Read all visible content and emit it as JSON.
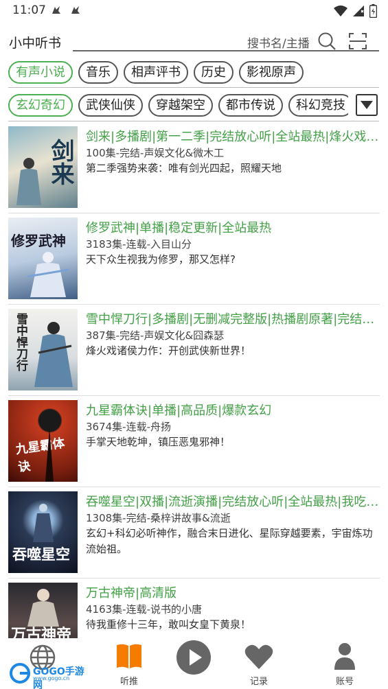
{
  "status_bar": {
    "time": "11:07"
  },
  "header": {
    "title": "小中听书",
    "search_placeholder": "搜书名/主播"
  },
  "main_categories": [
    {
      "label": "有声小说",
      "active": true
    },
    {
      "label": "音乐",
      "active": false
    },
    {
      "label": "相声评书",
      "active": false
    },
    {
      "label": "历史",
      "active": false
    },
    {
      "label": "影视原声",
      "active": false
    }
  ],
  "sub_categories": [
    {
      "label": "玄幻奇幻",
      "active": true
    },
    {
      "label": "武侠仙侠",
      "active": false
    },
    {
      "label": "穿越架空",
      "active": false
    },
    {
      "label": "都市传说",
      "active": false
    },
    {
      "label": "科幻竞技",
      "active": false
    }
  ],
  "books": [
    {
      "cover_text": "剑来",
      "title": "剑来|多播剧|第一二季|完结放心听|全站最热|烽火戏诸侯",
      "meta": "100集-完结-声娱文化&微木工",
      "desc": "第二季强势来袭：唯有剑光四起，照耀天地"
    },
    {
      "cover_text": "修罗武神",
      "title": "修罗武神|单播|稳定更新|全站最热",
      "meta": "3183集-连载-入目山分",
      "desc": "天下众生视我为修罗，那又怎样?"
    },
    {
      "cover_text": "雪中悍刀行",
      "title": "雪中悍刀行|多播剧|无删减完整版|热播剧原著|完结放心听",
      "meta": "387集-完结-声娱文化&囧森瑟",
      "desc": "烽火戏诸侯力作：开创武侠新世界！"
    },
    {
      "cover_text": "九星霸体诀",
      "title": "九星霸体诀|单播|高品质|爆款玄幻",
      "meta": "3674集-连载-舟扬",
      "desc": "手掌天地乾坤，镇压恶鬼邪神！"
    },
    {
      "cover_text": "吞噬星空",
      "title": "吞噬星空|双播|流逝演播|完结放心听|全站最热|我吃西红柿",
      "meta": "1308集-完结-桑梓讲故事&流逝",
      "desc": "玄幻+科幻必听神作，融合末日进化、星际穿越要素，宇宙炼功流始祖。"
    },
    {
      "cover_text": "万古神帝",
      "title": "万古神帝|高清版",
      "meta": "4163集-连载-说书的小唐",
      "desc": "待我重修十三年，敢叫女皇下黄泉！"
    }
  ],
  "bottom_nav": [
    {
      "label": "",
      "icon": "globe-icon"
    },
    {
      "label": "听推",
      "icon": "book-icon"
    },
    {
      "label": "",
      "icon": "play-icon"
    },
    {
      "label": "记录",
      "icon": "heart-icon"
    },
    {
      "label": "账号",
      "icon": "person-icon"
    }
  ],
  "watermark": {
    "text": "GOGO手游网",
    "sub": "www.gogo.cn"
  },
  "colors": {
    "accent": "#4caf50",
    "nav_book": "#f57c00",
    "nav_icon": "#666666"
  }
}
